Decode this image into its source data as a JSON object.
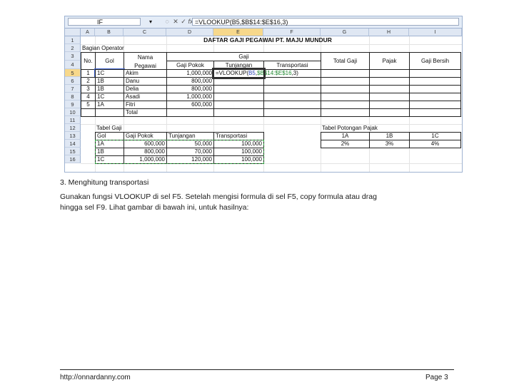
{
  "excel": {
    "name_box": "IF",
    "formula": "=VLOOKUP(B5,$B$14:$E$16,3)",
    "columns": [
      "A",
      "B",
      "C",
      "D",
      "E",
      "F",
      "G",
      "H",
      "I"
    ],
    "rows": [
      "1",
      "2",
      "3",
      "4",
      "5",
      "6",
      "7",
      "8",
      "9",
      "10",
      "11",
      "12",
      "13",
      "14",
      "15",
      "16"
    ],
    "title": "DAFTAR GAJI PEGAWAI PT. MAJU MUNDUR",
    "section": "Bagian Operator",
    "headers": {
      "no": "No.",
      "gol": "Gol",
      "nama": "Nama",
      "pegawai": "Pegawai",
      "gaji": "Gaji",
      "gaji_pokok": "Gaji Pokok",
      "tunjangan": "Tunjangan",
      "transportasi": "Transportasi",
      "total_gaji": "Total Gaji",
      "pajak": "Pajak",
      "gaji_bersih": "Gaji Bersih"
    },
    "employees": [
      {
        "no": "1",
        "gol": "1C",
        "nama": "Akim",
        "gaji_pokok": "1,000,000"
      },
      {
        "no": "2",
        "gol": "1B",
        "nama": "Danu",
        "gaji_pokok": "800,000"
      },
      {
        "no": "3",
        "gol": "1B",
        "nama": "Delia",
        "gaji_pokok": "800,000"
      },
      {
        "no": "4",
        "gol": "1C",
        "nama": "Asadi",
        "gaji_pokok": "1,000,000"
      },
      {
        "no": "5",
        "gol": "1A",
        "nama": "Fitri",
        "gaji_pokok": "600,000"
      }
    ],
    "active_formula": {
      "prefix": "=VLOOKUP(",
      "ref1": "B5",
      "sep": ",",
      "ref2": "$B$14:$E$16",
      "suffix": ",3)"
    },
    "total_label": "Total",
    "tabel_gaji": {
      "title": "Tabel Gaji",
      "headers": [
        "Gol",
        "Gaji Pokok",
        "Tunjangan",
        "Transportasi"
      ],
      "rows": [
        [
          "1A",
          "600,000",
          "50,000",
          "100,000"
        ],
        [
          "1B",
          "800,000",
          "70,000",
          "100,000"
        ],
        [
          "1C",
          "1,000,000",
          "120,000",
          "100,000"
        ]
      ]
    },
    "tabel_pajak": {
      "title": "Tabel Potongan Pajak",
      "headers": [
        "1A",
        "1B",
        "1C"
      ],
      "values": [
        "2%",
        "3%",
        "4%"
      ]
    }
  },
  "doc": {
    "heading": "3. Menghitung transportasi",
    "para_line1": "Gunakan fungsi VLOOKUP di sel F5. Setelah mengisi formula di sel F5, copy formula atau drag",
    "para_line2": "hingga sel F9. Lihat gambar di bawah ini, untuk hasilnya:",
    "footer_left": "http://onnardanny.com",
    "footer_right": "Page 3"
  }
}
